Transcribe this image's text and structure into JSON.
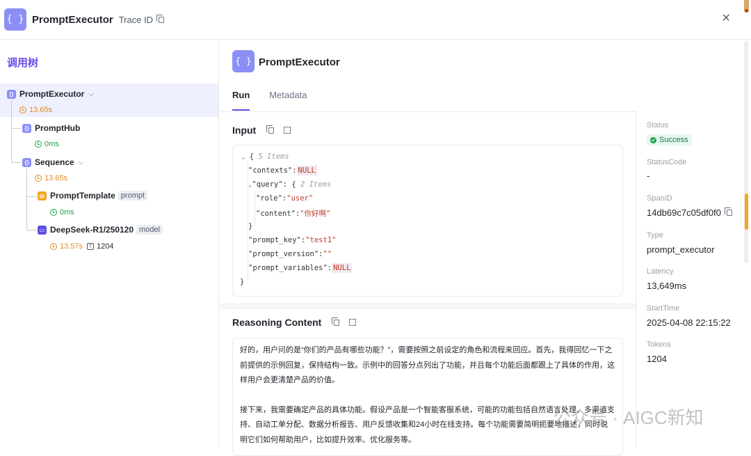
{
  "header": {
    "title": "PromptExecutor",
    "trace_label": "Trace ID",
    "icon_text": "{ }",
    "close": "×"
  },
  "tree": {
    "title": "调用树",
    "nodes": [
      {
        "name": "PromptExecutor",
        "meta": "13.65s"
      },
      {
        "name": "PromptHub",
        "meta": "0ms"
      },
      {
        "name": "Sequence",
        "meta": "13.65s"
      },
      {
        "name": "PromptTemplate",
        "tag": "prompt",
        "meta": "0ms"
      },
      {
        "name": "DeepSeek-R1/250120",
        "tag": "model",
        "meta": "13.57s",
        "tokens": "1204"
      }
    ]
  },
  "main": {
    "title": "PromptExecutor",
    "tabs": [
      "Run",
      "Metadata"
    ],
    "input_title": "Input",
    "json": {
      "open": "{",
      "items5": "5 Items",
      "k_contexts": "\"contexts\":",
      "null": "NULL",
      "k_query": "\"query\":",
      "qopen": "{",
      "items2": "2 Items",
      "k_role": "\"role\":",
      "v_role": "\"user\"",
      "k_content": "\"content\":",
      "v_content": "\"你好啊\"",
      "qclose": "}",
      "k_prompt_key": "\"prompt_key\":",
      "v_prompt_key": "\"test1\"",
      "k_prompt_version": "\"prompt_version\":",
      "v_prompt_version": "\"\"",
      "k_prompt_variables": "\"prompt_variables\":",
      "close": "}"
    },
    "reasoning_title": "Reasoning Content",
    "reasoning_p1": "好的，用户问的是“你们的产品有哪些功能？”，需要按照之前设定的角色和流程来回应。首先，我得回忆一下之前提供的示例回复，保持结构一致。示例中的回答分点列出了功能，并且每个功能后面都跟上了具体的作用，这样用户会更清楚产品的价值。",
    "reasoning_p2": "接下来，我需要确定产品的具体功能。假设产品是一个智能客服系统，可能的功能包括自然语言处理、多渠道支持、自动工单分配、数据分析报告、用户反馈收集和24小时在线支持。每个功能需要简明扼要地描述，同时说明它们如何帮助用户，比如提升效率、优化服务等。"
  },
  "details": {
    "status_label": "Status",
    "status_value": "Success",
    "statuscode_label": "StatusCode",
    "statuscode_value": "-",
    "spanid_label": "SpanID",
    "spanid_value": "14db69c7c05df0f0",
    "type_label": "Type",
    "type_value": "prompt_executor",
    "latency_label": "Latency",
    "latency_value": "13,649ms",
    "starttime_label": "StartTime",
    "starttime_value": "2025-04-08 22:15:22",
    "tokens_label": "Tokens",
    "tokens_value": "1204"
  },
  "watermark": "公众号 · AIGC新知",
  "colors": {
    "accent": "#5b4fe0",
    "tree_title": "#6b4ce6",
    "success": "#16a34a",
    "latency": "#e08a1e"
  }
}
